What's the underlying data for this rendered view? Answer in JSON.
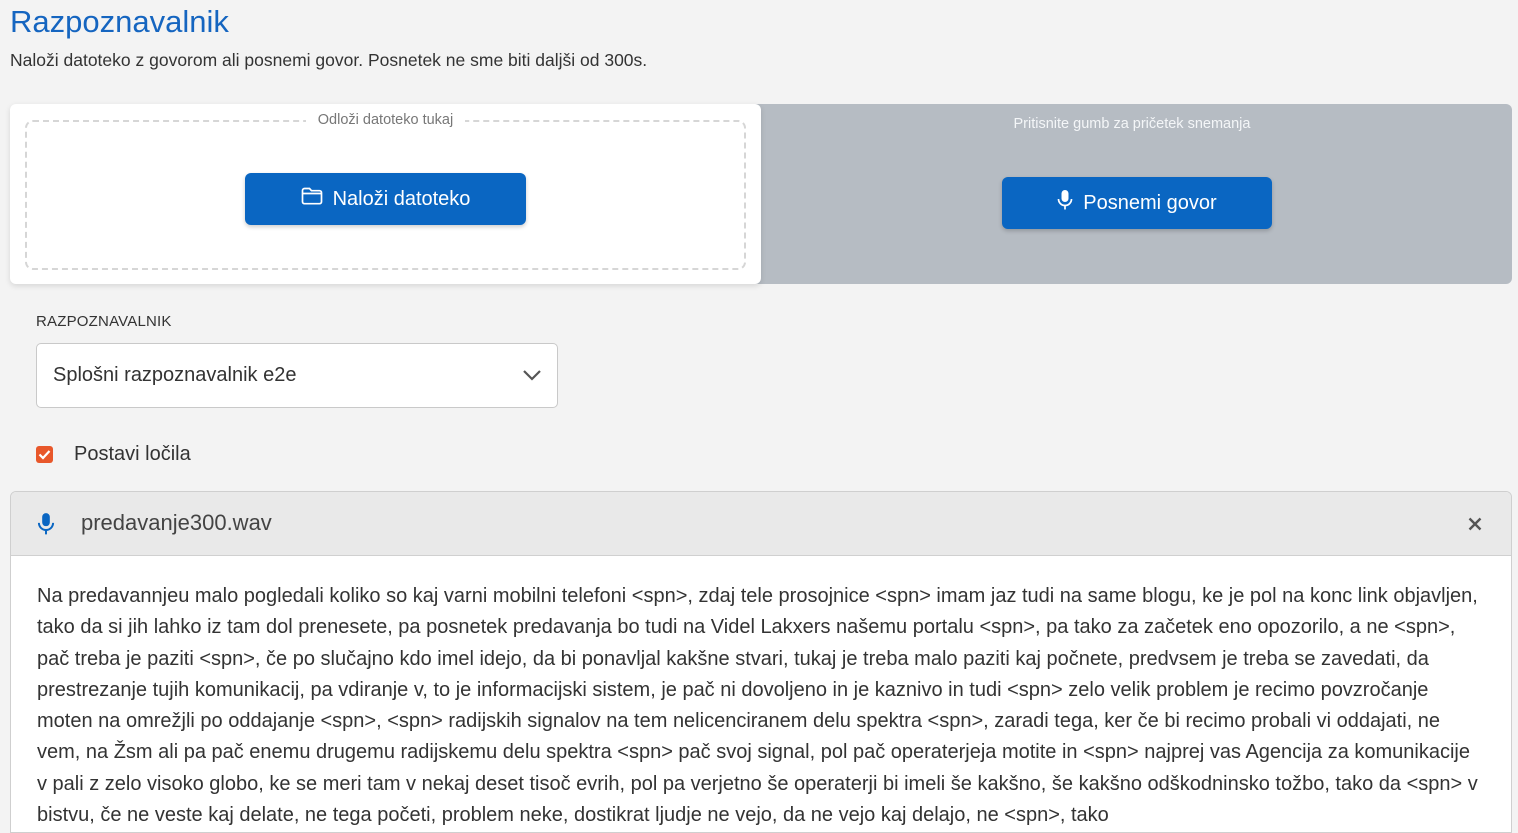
{
  "page": {
    "title": "Razpoznavalnik",
    "subtitle": "Naloži datoteko z govorom ali posnemi govor. Posnetek ne sme biti daljši od 300s."
  },
  "upload": {
    "dropzone_label": "Odloži datoteko tukaj",
    "button_label": "Naloži datoteko",
    "icon": "folder-icon"
  },
  "record": {
    "hint": "Pritisnite gumb za pričetek snemanja",
    "button_label": "Posnemi govor",
    "icon": "microphone-icon"
  },
  "recognizer": {
    "label": "RAZPOZNAVALNIK",
    "selected": "Splošni razpoznavalnik e2e"
  },
  "punctuation": {
    "label": "Postavi ločila",
    "checked": true
  },
  "result": {
    "filename": "predavanje300.wav",
    "transcript": "Na predavannjeu malo pogledali koliko so kaj varni mobilni telefoni <spn>, zdaj tele prosojnice <spn> imam jaz tudi na same blogu, ke je pol na konc link objavljen, tako da si jih lahko iz tam dol prenesete, pa posnetek predavanja bo tudi na Videl Lakxers našemu portalu <spn>, pa tako za začetek eno opozorilo, a ne <spn>, pač treba je paziti <spn>, če po slučajno kdo imel idejo, da bi ponavljal kakšne stvari, tukaj je treba malo paziti kaj počnete, predvsem je treba se zavedati, da prestrezanje tujih komunikacij, pa vdiranje v, to je informacijski sistem, je pač ni dovoljeno in je kaznivo in tudi <spn> zelo velik problem je recimo povzročanje moten na omrežjli po oddajanje <spn>, <spn> radijskih signalov na tem nelicenciranem delu spektra <spn>, zaradi tega, ker če bi recimo probali vi oddajati, ne vem, na Žsm ali pa pač enemu drugemu radijskemu delu spektra <spn> pač svoj signal, pol pač operaterjeja motite in <spn> najprej vas Agencija za komunikacije v pali z zelo visoko globo, ke se meri tam v nekaj deset tisoč evrih, pol pa verjetno še operaterji bi imeli še kakšno, še kakšno odškodninsko tožbo, tako da <spn> v bistvu, če ne veste kaj delate, ne tega početi, problem neke, dostikrat ljudje ne vejo, da ne vejo kaj delajo, ne <spn>, tako"
  },
  "colors": {
    "primary": "#0a66c2",
    "title": "#1565c0",
    "checkbox": "#e8572a",
    "record_panel": "#b6bcc3"
  }
}
